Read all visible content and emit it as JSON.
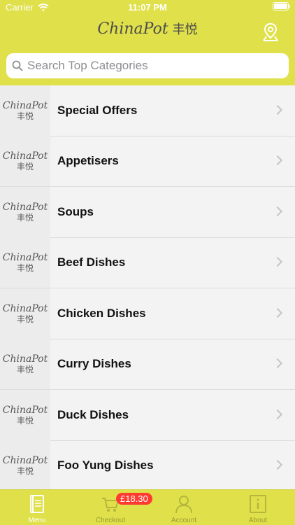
{
  "status_bar": {
    "carrier": "Carrier",
    "time": "11:07 PM"
  },
  "nav": {
    "logo_script_main": "China",
    "logo_script_small": "",
    "logo_script_tail": "Pot",
    "logo_cjk": "丰悦"
  },
  "search": {
    "placeholder": "Search Top Categories"
  },
  "categories": [
    {
      "label": "Special Offers"
    },
    {
      "label": "Appetisers"
    },
    {
      "label": "Soups"
    },
    {
      "label": "Beef Dishes"
    },
    {
      "label": "Chicken Dishes"
    },
    {
      "label": "Curry Dishes"
    },
    {
      "label": "Duck Dishes"
    },
    {
      "label": "Foo Yung Dishes"
    }
  ],
  "thumb": {
    "script": "ChinaPot",
    "cjk": "丰悦"
  },
  "tabbar": {
    "menu": "Menu",
    "checkout": "Checkout",
    "checkout_badge": "£18.30",
    "account": "Account",
    "about": "About"
  },
  "colors": {
    "accent": "#dfe04a",
    "badge": "#ff3b30"
  }
}
